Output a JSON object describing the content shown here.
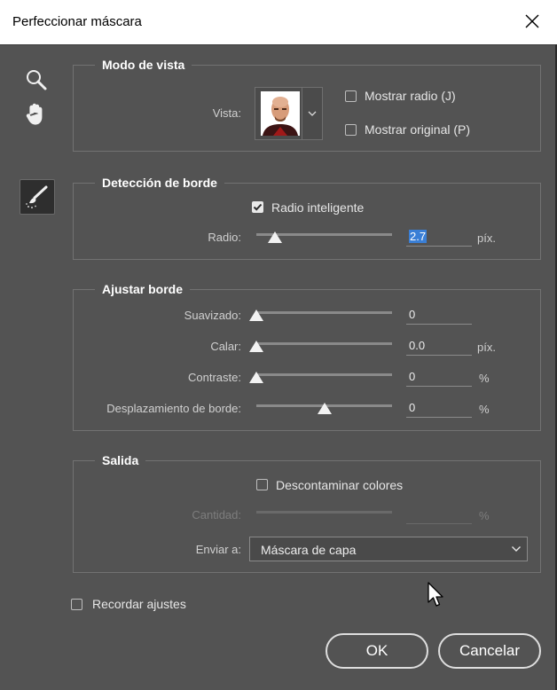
{
  "window": {
    "title": "Perfeccionar máscara"
  },
  "tools": {
    "zoom": "zoom-icon",
    "hand": "hand-icon",
    "brush": "refine-brush-icon"
  },
  "view_mode": {
    "title": "Modo de vista",
    "view_label": "Vista:",
    "show_radius": "Mostrar radio (J)",
    "show_original": "Mostrar original (P)"
  },
  "edge_detection": {
    "title": "Detección de borde",
    "smart_radius": "Radio inteligente",
    "smart_radius_checked": true,
    "radius_label": "Radio:",
    "radius_value": "2.7",
    "radius_unit": "píx."
  },
  "adjust_edge": {
    "title": "Ajustar borde",
    "smooth_label": "Suavizado:",
    "smooth_value": "0",
    "feather_label": "Calar:",
    "feather_value": "0.0",
    "feather_unit": "píx.",
    "contrast_label": "Contraste:",
    "contrast_value": "0",
    "contrast_unit": "%",
    "shift_label": "Desplazamiento de borde:",
    "shift_value": "0",
    "shift_unit": "%"
  },
  "output": {
    "title": "Salida",
    "decontaminate": "Descontaminar colores",
    "amount_label": "Cantidad:",
    "amount_unit": "%",
    "send_to_label": "Enviar a:",
    "send_to_value": "Máscara de capa"
  },
  "remember": "Recordar ajustes",
  "buttons": {
    "ok": "OK",
    "cancel": "Cancelar"
  },
  "colors": {
    "background": "#535353",
    "title_bar": "#ffffff",
    "selection": "#3a7fd6"
  }
}
